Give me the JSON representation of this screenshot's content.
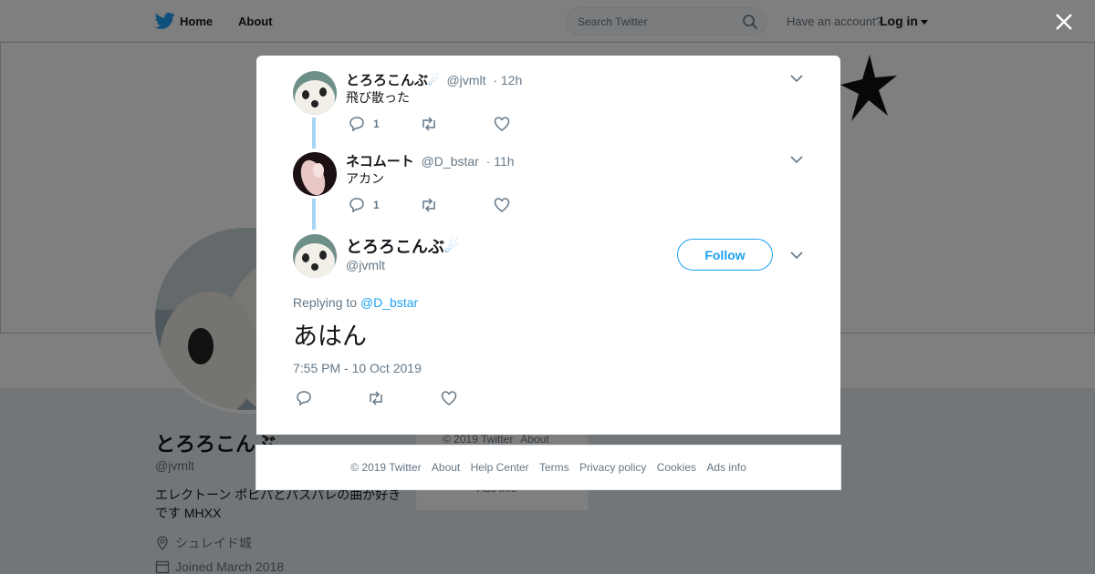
{
  "topbar": {
    "nav_home": "Home",
    "nav_about": "About",
    "search_placeholder": "Search Twitter",
    "have_account": "Have an account?",
    "login": "Log in"
  },
  "profile": {
    "name": "とろろこんぶ",
    "handle": "@jvmlt",
    "bio": "エレクトーン ポピパとパスパレの曲が好きです MHXX",
    "location": "シュレイド城",
    "joined": "Joined March 2018"
  },
  "sidebar": {
    "copyright": "© 2019 Twitter",
    "about": "About",
    "ads_info": "Ads info"
  },
  "thread": [
    {
      "name": "とろろこんぶ",
      "handle": "@jvmlt",
      "time": "· 12h",
      "text": "飛び散った",
      "reply_count": "1"
    },
    {
      "name": "ネコムート",
      "handle": "@D_bstar",
      "time": "· 11h",
      "text": "アカン",
      "reply_count": "1"
    }
  ],
  "main_tweet": {
    "name": "とろろこんぶ",
    "handle": "@jvmlt",
    "follow_label": "Follow",
    "replying_prefix": "Replying to",
    "replying_to": "@D_bstar",
    "text": "あはん",
    "timestamp": "7:55 PM - 10 Oct 2019"
  },
  "footer": {
    "copyright": "© 2019 Twitter",
    "about": "About",
    "help": "Help Center",
    "terms": "Terms",
    "privacy": "Privacy policy",
    "cookies": "Cookies",
    "ads": "Ads info"
  },
  "colors": {
    "accent": "#1da1f2",
    "thread_line": "#a8d5f5",
    "muted": "#657786",
    "overlay": "rgba(0,0,0,0.5)"
  }
}
